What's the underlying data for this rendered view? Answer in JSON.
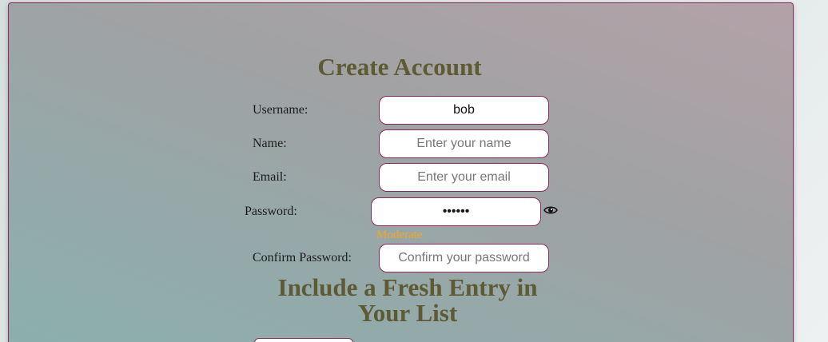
{
  "form": {
    "title": "Create Account",
    "username": {
      "label": "Username:",
      "value": "bob",
      "placeholder": ""
    },
    "name": {
      "label": "Name:",
      "value": "",
      "placeholder": "Enter your name"
    },
    "email": {
      "label": "Email:",
      "value": "",
      "placeholder": "Enter your email"
    },
    "password": {
      "label": "Password:",
      "value": "******",
      "placeholder": ""
    },
    "password_strength": {
      "text": "Moderate",
      "color": "#f5a623"
    },
    "confirm_password": {
      "label": "Confirm Password:",
      "value": "",
      "placeholder": "Confirm your password"
    }
  },
  "section": {
    "title": "Include a Fresh Entry in Your List"
  },
  "icons": {
    "toggle_password": "eye-icon"
  },
  "colors": {
    "accent_border": "#8a2a5c",
    "heading": "#5e5a34"
  }
}
